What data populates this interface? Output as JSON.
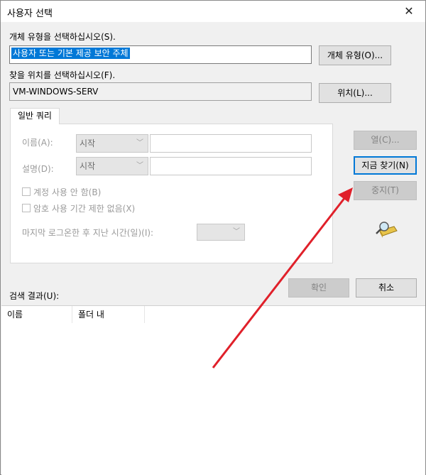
{
  "window": {
    "title": "사용자 선택",
    "close_glyph": "✕"
  },
  "object_type": {
    "label": "개체 유형을 선택하십시오(S).",
    "value": "사용자 또는 기본 제공 보안 주체",
    "button": "개체 유형(O)..."
  },
  "location": {
    "label": "찾을 위치를 선택하십시오(F).",
    "value": "VM-WINDOWS-SERV",
    "button": "위치(L)..."
  },
  "tab": {
    "label": "일반 쿼리"
  },
  "query": {
    "name_label": "이름(A):",
    "name_mode": "시작",
    "name_value": "",
    "desc_label": "설명(D):",
    "desc_mode": "시작",
    "desc_value": "",
    "disabled_accounts": "계정 사용 안 함(B)",
    "non_expiring_pw": "암호 사용 기간 제한 없음(X)",
    "days_since_logon": "마지막 로그온한 후 지난 시간(일)(I):",
    "days_value": ""
  },
  "buttons": {
    "columns": "열(C)...",
    "find_now": "지금 찾기(N)",
    "stop": "중지(T)",
    "ok": "확인",
    "cancel": "취소"
  },
  "results": {
    "label": "검색 결과(U):",
    "columns": [
      "이름",
      "폴더 내"
    ]
  },
  "icons": {
    "search": "search-icon"
  },
  "colors": {
    "annotation_arrow": "#e0202a",
    "selection": "#0078d7"
  }
}
